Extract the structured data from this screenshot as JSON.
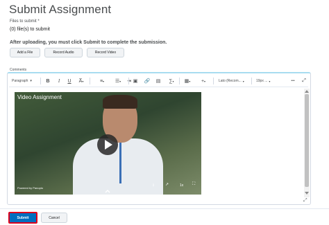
{
  "page": {
    "title": "Submit Assignment"
  },
  "files": {
    "label": "Files to submit *",
    "count_text": "(0) file(s) to submit"
  },
  "upload_note": "After uploading, you must click Submit to complete the submission.",
  "upload_buttons": {
    "add_file": "Add a File",
    "record_audio": "Record Audio",
    "record_video": "Record Video"
  },
  "comments": {
    "label": "Comments"
  },
  "toolbar": {
    "paragraph": "Paragraph",
    "font": "Lato (Recom...",
    "size": "19px ...",
    "more": "•••"
  },
  "video": {
    "title": "Video Assignment",
    "powered_by": "Powered by Panopto",
    "speed": "1x"
  },
  "actions": {
    "submit": "Submit",
    "cancel": "Cancel"
  },
  "colors": {
    "accent": "#006fbf",
    "highlight_border": "#e0001b",
    "editor_top_border": "#a8dcf0"
  }
}
